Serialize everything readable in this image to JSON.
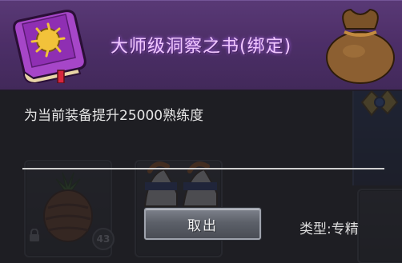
{
  "dialog": {
    "title": "大师级洞察之书(绑定)",
    "description": "为当前装备提升25000熟练度",
    "take_button_label": "取出",
    "type_label": "类型:专精"
  },
  "background_inventory": {
    "item_count": "43"
  },
  "icons": {
    "book": "purple-book-icon",
    "bag": "loot-bag-icon",
    "lock": "lock-icon"
  },
  "colors": {
    "header_bg": "#5e3b7c",
    "title_text": "#f0c6ff",
    "body_bg": "#1e1e22",
    "button_bg": "#5c6069"
  }
}
